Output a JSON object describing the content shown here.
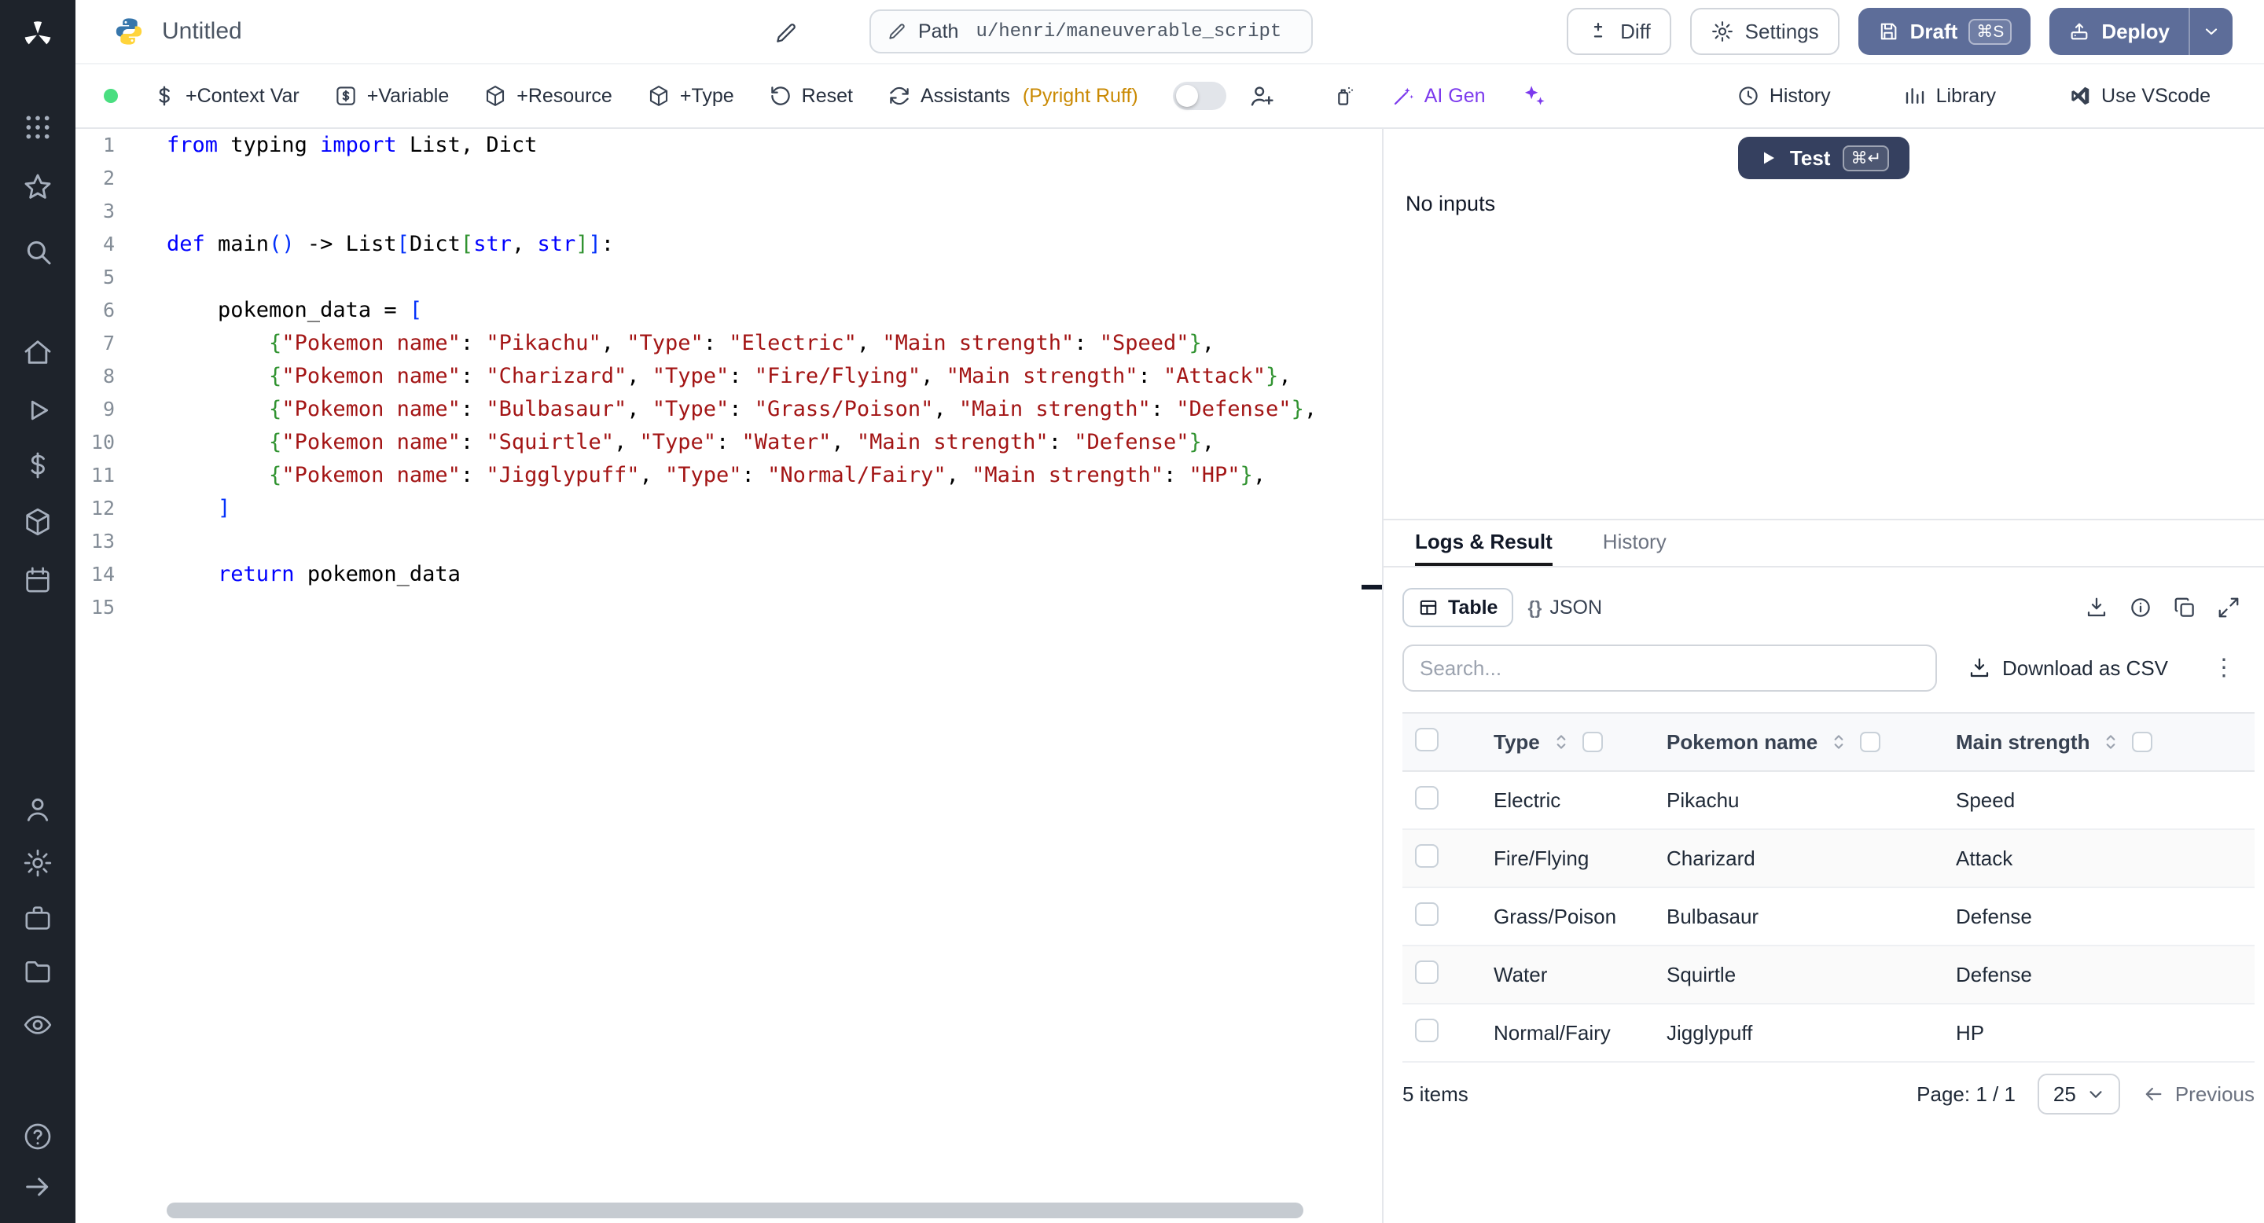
{
  "colors": {
    "primary_button": "#5d6d99",
    "test_button": "#35405f",
    "keyword": "#0000ff",
    "string": "#a31515",
    "bracket1": "#0431fa",
    "bracket2": "#319331",
    "ai": "#7c3aed",
    "assistant_status": "#ca8a04",
    "green_dot": "#4ade80",
    "sidebar_bg": "#1e232b"
  },
  "header": {
    "title": "Untitled",
    "path_label": "Path",
    "path_value": "u/henri/maneuverable_script",
    "diff": "Diff",
    "settings": "Settings",
    "draft": "Draft",
    "draft_kbd": "⌘S",
    "deploy": "Deploy"
  },
  "toolbar": {
    "context_var": "+Context Var",
    "variable": "+Variable",
    "resource": "+Resource",
    "type": "+Type",
    "reset": "Reset",
    "assistants": "Assistants",
    "assistants_status": "(Pyright Ruff)",
    "ai_gen": "AI Gen",
    "history": "History",
    "library": "Library",
    "vscode": "Use VScode"
  },
  "editor": {
    "line_count": 15,
    "lines": [
      [
        [
          "k",
          "from"
        ],
        [
          "p",
          " typing "
        ],
        [
          "k",
          "import"
        ],
        [
          "p",
          " List, Dict"
        ]
      ],
      [],
      [],
      [
        [
          "k",
          "def"
        ],
        [
          "p",
          " main"
        ],
        [
          "b1",
          "()"
        ],
        [
          "p",
          " -> List"
        ],
        [
          "b1",
          "["
        ],
        [
          "p",
          "Dict"
        ],
        [
          "b2",
          "["
        ],
        [
          "k",
          "str"
        ],
        [
          "p",
          ", "
        ],
        [
          "k",
          "str"
        ],
        [
          "b2",
          "]"
        ],
        [
          "b1",
          "]"
        ],
        [
          "p",
          ":"
        ]
      ],
      [],
      [
        [
          "p",
          "    pokemon_data = "
        ],
        [
          "b1",
          "["
        ]
      ],
      [
        [
          "p",
          "        "
        ],
        [
          "b2",
          "{"
        ],
        [
          "s",
          "\"Pokemon name\""
        ],
        [
          "p",
          ": "
        ],
        [
          "s",
          "\"Pikachu\""
        ],
        [
          "p",
          ", "
        ],
        [
          "s",
          "\"Type\""
        ],
        [
          "p",
          ": "
        ],
        [
          "s",
          "\"Electric\""
        ],
        [
          "p",
          ", "
        ],
        [
          "s",
          "\"Main strength\""
        ],
        [
          "p",
          ": "
        ],
        [
          "s",
          "\"Speed\""
        ],
        [
          "b2",
          "}"
        ],
        [
          "p",
          ","
        ]
      ],
      [
        [
          "p",
          "        "
        ],
        [
          "b2",
          "{"
        ],
        [
          "s",
          "\"Pokemon name\""
        ],
        [
          "p",
          ": "
        ],
        [
          "s",
          "\"Charizard\""
        ],
        [
          "p",
          ", "
        ],
        [
          "s",
          "\"Type\""
        ],
        [
          "p",
          ": "
        ],
        [
          "s",
          "\"Fire/Flying\""
        ],
        [
          "p",
          ", "
        ],
        [
          "s",
          "\"Main strength\""
        ],
        [
          "p",
          ": "
        ],
        [
          "s",
          "\"Attack\""
        ],
        [
          "b2",
          "}"
        ],
        [
          "p",
          ","
        ]
      ],
      [
        [
          "p",
          "        "
        ],
        [
          "b2",
          "{"
        ],
        [
          "s",
          "\"Pokemon name\""
        ],
        [
          "p",
          ": "
        ],
        [
          "s",
          "\"Bulbasaur\""
        ],
        [
          "p",
          ", "
        ],
        [
          "s",
          "\"Type\""
        ],
        [
          "p",
          ": "
        ],
        [
          "s",
          "\"Grass/Poison\""
        ],
        [
          "p",
          ", "
        ],
        [
          "s",
          "\"Main strength\""
        ],
        [
          "p",
          ": "
        ],
        [
          "s",
          "\"Defense\""
        ],
        [
          "b2",
          "}"
        ],
        [
          "p",
          ","
        ]
      ],
      [
        [
          "p",
          "        "
        ],
        [
          "b2",
          "{"
        ],
        [
          "s",
          "\"Pokemon name\""
        ],
        [
          "p",
          ": "
        ],
        [
          "s",
          "\"Squirtle\""
        ],
        [
          "p",
          ", "
        ],
        [
          "s",
          "\"Type\""
        ],
        [
          "p",
          ": "
        ],
        [
          "s",
          "\"Water\""
        ],
        [
          "p",
          ", "
        ],
        [
          "s",
          "\"Main strength\""
        ],
        [
          "p",
          ": "
        ],
        [
          "s",
          "\"Defense\""
        ],
        [
          "b2",
          "}"
        ],
        [
          "p",
          ","
        ]
      ],
      [
        [
          "p",
          "        "
        ],
        [
          "b2",
          "{"
        ],
        [
          "s",
          "\"Pokemon name\""
        ],
        [
          "p",
          ": "
        ],
        [
          "s",
          "\"Jigglypuff\""
        ],
        [
          "p",
          ", "
        ],
        [
          "s",
          "\"Type\""
        ],
        [
          "p",
          ": "
        ],
        [
          "s",
          "\"Normal/Fairy\""
        ],
        [
          "p",
          ", "
        ],
        [
          "s",
          "\"Main strength\""
        ],
        [
          "p",
          ": "
        ],
        [
          "s",
          "\"HP\""
        ],
        [
          "b2",
          "}"
        ],
        [
          "p",
          ","
        ]
      ],
      [
        [
          "p",
          "    "
        ],
        [
          "b1",
          "]"
        ]
      ],
      [],
      [
        [
          "p",
          "    "
        ],
        [
          "k",
          "return"
        ],
        [
          "p",
          " pokemon_data"
        ]
      ],
      []
    ]
  },
  "runner": {
    "test": "Test",
    "test_kbd": "⌘↵",
    "no_inputs": "No inputs"
  },
  "results": {
    "tab_logs": "Logs & Result",
    "tab_history": "History",
    "view_table": "Table",
    "view_json": "JSON",
    "json_glyph": "{}",
    "search_placeholder": "Search...",
    "download_csv": "Download as CSV",
    "kebab_glyph": "⋮",
    "table": {
      "columns": [
        "Type",
        "Pokemon name",
        "Main strength"
      ],
      "rows": [
        [
          "Electric",
          "Pikachu",
          "Speed"
        ],
        [
          "Fire/Flying",
          "Charizard",
          "Attack"
        ],
        [
          "Grass/Poison",
          "Bulbasaur",
          "Defense"
        ],
        [
          "Water",
          "Squirtle",
          "Defense"
        ],
        [
          "Normal/Fairy",
          "Jigglypuff",
          "HP"
        ]
      ]
    },
    "footer": {
      "items": "5 items",
      "page": "Page: 1 / 1",
      "page_size": "25",
      "previous": "Previous"
    }
  }
}
